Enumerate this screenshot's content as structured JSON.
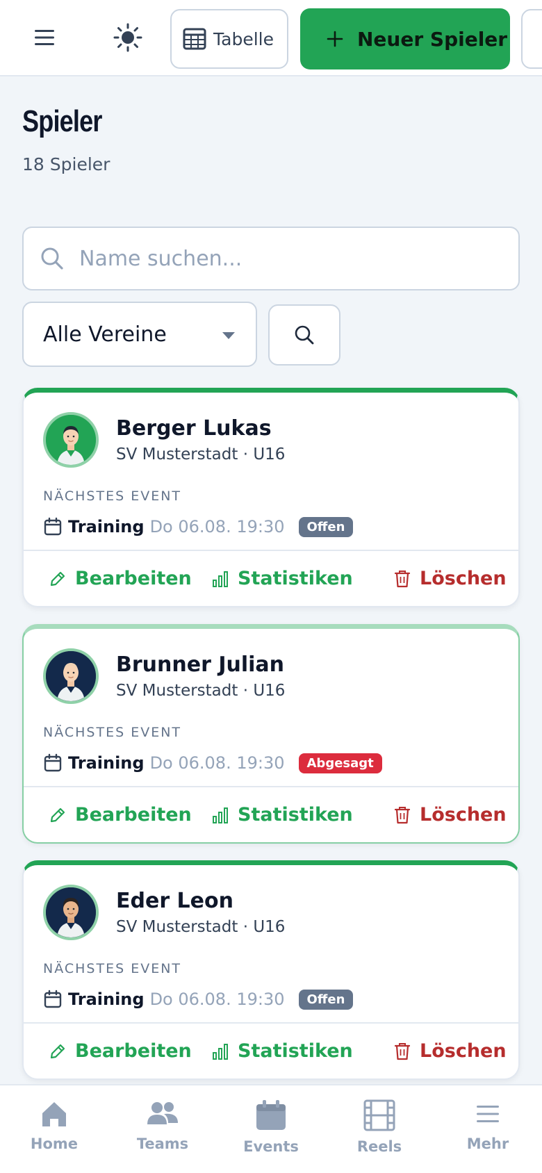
{
  "header": {
    "table_label": "Tabelle",
    "new_player_label": "Neuer Spieler"
  },
  "page": {
    "title": "Spieler",
    "subtitle": "18 Spieler"
  },
  "search": {
    "placeholder": "Name suchen...",
    "value": ""
  },
  "filter": {
    "club_selected": "Alle Vereine"
  },
  "players": [
    {
      "name": "Berger Lukas",
      "meta": "SV Musterstadt · U16",
      "event_heading": "NÄCHSTES EVENT",
      "event_type": "Training",
      "event_date": "Do 06.08. 19:30",
      "status": "Offen"
    },
    {
      "name": "Brunner Julian",
      "meta": "SV Musterstadt · U16",
      "event_heading": "NÄCHSTES EVENT",
      "event_type": "Training",
      "event_date": "Do 06.08. 19:30",
      "status": "Abgesagt"
    },
    {
      "name": "Eder Leon",
      "meta": "SV Musterstadt · U16",
      "event_heading": "NÄCHSTES EVENT",
      "event_type": "Training",
      "event_date": "Do 06.08. 19:30",
      "status": "Offen"
    }
  ],
  "actions": {
    "edit": "Bearbeiten",
    "stats": "Statistiken",
    "delete": "Löschen"
  },
  "nav": {
    "home": "Home",
    "teams": "Teams",
    "events": "Events",
    "reels": "Reels",
    "more": "Mehr"
  },
  "colors": {
    "accent": "#22a455",
    "danger": "#b62d2d",
    "badge_open": "#64748b",
    "badge_cancelled": "#dc2c3d"
  },
  "icons": {
    "menu": "menu-icon",
    "theme": "sun-icon",
    "table": "table-icon",
    "add": "plus-icon",
    "search": "search-icon",
    "calendar": "calendar-icon",
    "edit": "pencil-icon",
    "stats": "bar-chart-icon",
    "delete": "trash-icon"
  }
}
